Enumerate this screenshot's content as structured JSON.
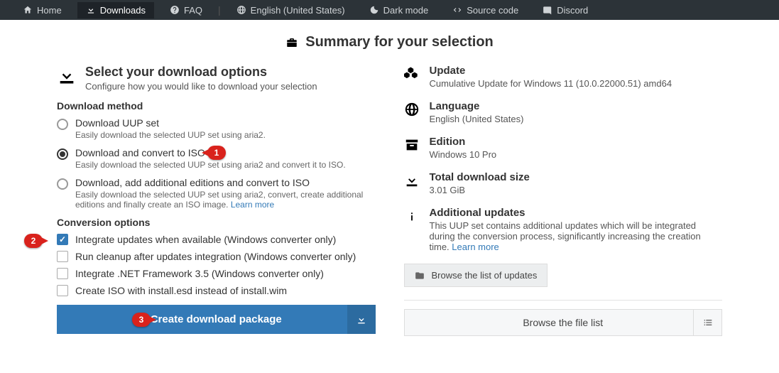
{
  "nav": {
    "home": "Home",
    "downloads": "Downloads",
    "faq": "FAQ",
    "language": "English (United States)",
    "darkmode": "Dark mode",
    "sourcecode": "Source code",
    "discord": "Discord"
  },
  "summary_title": "Summary for your selection",
  "left": {
    "title": "Select your download options",
    "subtitle": "Configure how you would like to download your selection",
    "method_heading": "Download method",
    "methods": [
      {
        "label": "Download UUP set",
        "desc": "Easily download the selected UUP set using aria2."
      },
      {
        "label": "Download and convert to ISO",
        "desc": "Easily download the selected UUP set using aria2 and convert it to ISO."
      },
      {
        "label": "Download, add additional editions and convert to ISO",
        "desc": "Easily download the selected UUP set using aria2, convert, create additional editions and finally create an ISO image."
      }
    ],
    "learn_more": "Learn more",
    "conv_heading": "Conversion options",
    "options": [
      "Integrate updates when available (Windows converter only)",
      "Run cleanup after updates integration (Windows converter only)",
      "Integrate .NET Framework 3.5 (Windows converter only)",
      "Create ISO with install.esd instead of install.wim"
    ],
    "create_btn": "Create download package"
  },
  "right": {
    "update_label": "Update",
    "update_value": "Cumulative Update for Windows 11 (10.0.22000.51) amd64",
    "language_label": "Language",
    "language_value": "English (United States)",
    "edition_label": "Edition",
    "edition_value": "Windows 10 Pro",
    "size_label": "Total download size",
    "size_value": "3.01 GiB",
    "addl_label": "Additional updates",
    "addl_value": "This UUP set contains additional updates which will be integrated during the conversion process, significantly increasing the creation time.",
    "learn_more": "Learn more",
    "browse_updates": "Browse the list of updates",
    "browse_files": "Browse the file list"
  },
  "callouts": {
    "c1": "1",
    "c2": "2",
    "c3": "3"
  }
}
